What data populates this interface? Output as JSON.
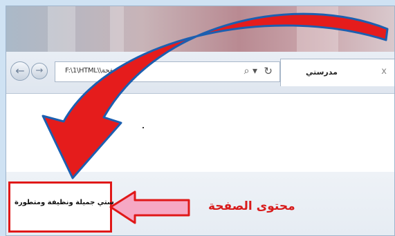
{
  "browser": {
    "address_url": "F:\\1\\HTML\\\\صفحة.htm",
    "search_glyph": "⌕ ▾",
    "refresh_glyph": "↻",
    "back_glyph": "←",
    "forward_glyph": "→",
    "tab_title": "مدرستي",
    "tab_close": "x"
  },
  "page": {
    "content_text": "مدرستي جميلة ونظيفة ومتطورة"
  },
  "annotation": {
    "label": "محتوى الصفحة"
  },
  "colors": {
    "accent_red": "#e01818",
    "arrow_pink": "#f6a8c4",
    "arrow_blue_edge": "#1c5fb0"
  }
}
